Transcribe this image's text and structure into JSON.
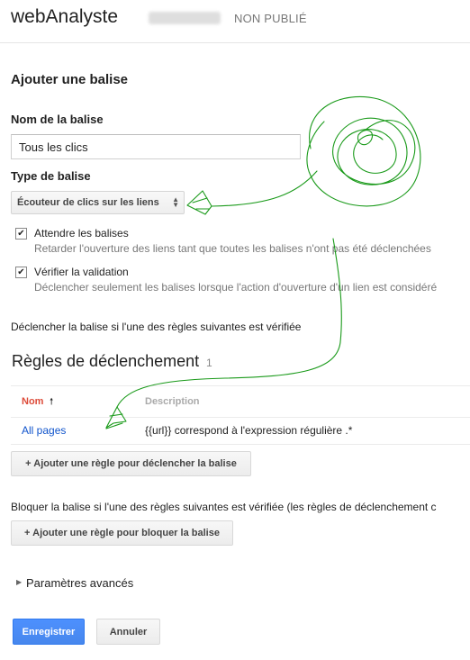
{
  "header": {
    "app_title": "webAnalyste",
    "status": "NON PUBLIÉ"
  },
  "section_title": "Ajouter une balise",
  "tag_name": {
    "label": "Nom de la balise",
    "value": "Tous les clics"
  },
  "tag_type": {
    "label": "Type de balise",
    "selected": "Écouteur de clics sur les liens"
  },
  "options": [
    {
      "title": "Attendre les balises",
      "description": "Retarder l'ouverture des liens tant que toutes les balises n'ont pas été déclenchées",
      "checked": true
    },
    {
      "title": "Vérifier la validation",
      "description": "Déclencher seulement les balises lorsque l'action d'ouverture d'un lien est considéré",
      "checked": true
    }
  ],
  "fire_text": "Déclencher la balise si l'une des règles suivantes est vérifiée",
  "rules": {
    "title": "Règles de déclenchement",
    "count": "1",
    "columns": [
      "Nom",
      "Description"
    ],
    "rows": [
      {
        "name": "All pages",
        "description": "{{url}} correspond à l'expression régulière .*"
      }
    ],
    "add_button": "+ Ajouter une règle pour déclencher la balise"
  },
  "block": {
    "text": "Bloquer la balise si l'une des règles suivantes est vérifiée (les règles de déclenchement c",
    "add_button": "+ Ajouter une règle pour bloquer la balise"
  },
  "advanced_label": "Paramètres avancés",
  "buttons": {
    "save": "Enregistrer",
    "cancel": "Annuler"
  },
  "colors": {
    "accent_blue": "#4d90fe",
    "link": "#1155cc",
    "sort_active": "#dd4b39",
    "annotation": "#1a9a1a"
  },
  "icons": {
    "checkbox_checked": "check-icon",
    "sort": "sort-up-arrow-icon",
    "select": "updown-chevron-icon",
    "advanced": "triangle-right-icon"
  }
}
